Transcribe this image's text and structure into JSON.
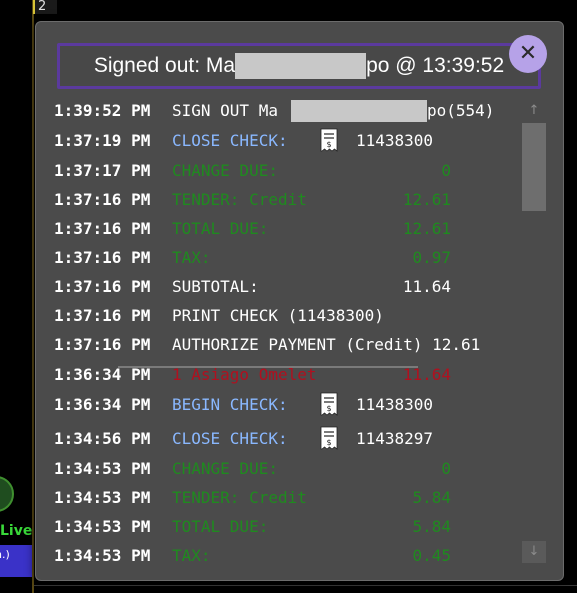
{
  "background": {
    "tab_label": "2",
    "live_label": "Live",
    "side_button_text": "in.)"
  },
  "dialog": {
    "title_prefix": "Signed out: Ma",
    "title_suffix": "po @ 13:39:52",
    "close_symbol": "✕"
  },
  "log": [
    {
      "time": "1:39:52 PM",
      "label": "SIGN OUT Ma",
      "label_tail": "po(554)",
      "value": "",
      "color": "white",
      "redacted": true
    },
    {
      "time": "1:37:19 PM",
      "label": "CLOSE CHECK:",
      "value": "11438300",
      "color": "blue",
      "receipt": true
    },
    {
      "time": "1:37:17 PM",
      "label": "CHANGE DUE:",
      "value": "0",
      "color": "green"
    },
    {
      "time": "1:37:16 PM",
      "label": "TENDER: Credit",
      "value": "12.61",
      "color": "green"
    },
    {
      "time": "1:37:16 PM",
      "label": "TOTAL DUE:",
      "value": "12.61",
      "color": "green"
    },
    {
      "time": "1:37:16 PM",
      "label": "TAX:",
      "value": "0.97",
      "color": "green"
    },
    {
      "time": "1:37:16 PM",
      "label": "SUBTOTAL:",
      "value": "11.64",
      "color": "white"
    },
    {
      "time": "1:37:16 PM",
      "label": "PRINT CHECK (11438300)",
      "value": "",
      "color": "white"
    },
    {
      "time": "1:37:16 PM",
      "label": "AUTHORIZE PAYMENT (Credit) 12.61",
      "value": "",
      "color": "white"
    },
    {
      "time": "1:36:34 PM",
      "label": "1 Asiago Omelet",
      "value": "11.64",
      "color": "red"
    },
    {
      "time": "1:36:34 PM",
      "label": "BEGIN CHECK:",
      "value": "11438300",
      "color": "blue",
      "receipt": true
    },
    {
      "time": "1:34:56 PM",
      "label": "CLOSE CHECK:",
      "value": "11438297",
      "color": "blue",
      "receipt": true
    },
    {
      "time": "1:34:53 PM",
      "label": "CHANGE DUE:",
      "value": "0",
      "color": "green"
    },
    {
      "time": "1:34:53 PM",
      "label": "TENDER: Credit",
      "value": "5.84",
      "color": "green"
    },
    {
      "time": "1:34:53 PM",
      "label": "TOTAL DUE:",
      "value": "5.84",
      "color": "green"
    },
    {
      "time": "1:34:53 PM",
      "label": "TAX:",
      "value": "0.45",
      "color": "green"
    }
  ],
  "scrollbar": {
    "up_symbol": "↑",
    "down_symbol": "↓"
  },
  "colors": {
    "accent_purple": "#5b3a9e",
    "close_button": "#b6a2e8",
    "blue_text": "#8ab8ff",
    "green_text": "#1f8a1f",
    "red_text": "#b0101f"
  }
}
